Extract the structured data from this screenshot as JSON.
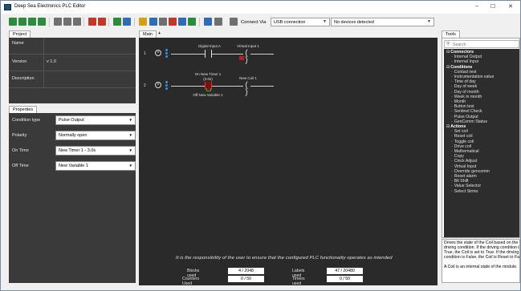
{
  "window": {
    "title": "Deep Sea Electronics PLC Editor",
    "controls": [
      "–",
      "☐",
      "✕"
    ]
  },
  "toolbar": {
    "connect_label": "Connect Via",
    "connection_type": "USB connection",
    "device": "No devices detected"
  },
  "project": {
    "tab_label": "Project",
    "rows": [
      {
        "label": "Name",
        "value": ""
      },
      {
        "label": "Version",
        "value": "v 1.0"
      },
      {
        "label": "Description",
        "value": ""
      }
    ]
  },
  "properties": {
    "tab_label": "Properties",
    "rows": [
      {
        "label": "Condition type",
        "value": "Pulse Output"
      },
      {
        "label": "Polarity",
        "value": "Normally open"
      },
      {
        "label": "On Time",
        "value": "New Timer 1 - 3.0s"
      },
      {
        "label": "Off Time",
        "value": "New Variable 1"
      }
    ]
  },
  "main": {
    "tab_label": "Main",
    "add_tab": "+",
    "rungs": [
      {
        "number": "1",
        "contact_label": "Digital Input A",
        "coil_label": "Virtual Input 1",
        "coil_symbol": "( )"
      },
      {
        "number": "2",
        "contact_label": "On New Timer 1",
        "contact_sublabel": "(3.0s)",
        "contact_bottom_label": "Off New Variable 1",
        "coil_label": "New Coil 1",
        "coil_symbol": "( )"
      }
    ],
    "notice": "It is the responsibility of the user to ensure that the configured PLC functionality operates as intended",
    "stats": [
      {
        "label": "Blocks used",
        "value": "4 / 2048"
      },
      {
        "label": "Labels used",
        "value": "47 / 20480"
      },
      {
        "label": "Counters Used",
        "value": "0 / 50"
      },
      {
        "label": "Timers used",
        "value": "0 / 50"
      }
    ]
  },
  "tools": {
    "tab_label": "Tools",
    "search_placeholder": "Search",
    "tree": [
      {
        "type": "cat",
        "label": "Connectors"
      },
      {
        "type": "item",
        "label": "Internal Output"
      },
      {
        "type": "item",
        "label": "Internal Input"
      },
      {
        "type": "cat",
        "label": "Conditions"
      },
      {
        "type": "item",
        "label": "Contact test"
      },
      {
        "type": "item",
        "label": "Instrumentation value"
      },
      {
        "type": "item",
        "label": "Time of day"
      },
      {
        "type": "item",
        "label": "Day of week"
      },
      {
        "type": "item",
        "label": "Day of month"
      },
      {
        "type": "item",
        "label": "Week in month"
      },
      {
        "type": "item",
        "label": "Month"
      },
      {
        "type": "item",
        "label": "Button test"
      },
      {
        "type": "item",
        "label": "Sentinel Check"
      },
      {
        "type": "item",
        "label": "Pulse Output"
      },
      {
        "type": "item",
        "label": "GenComm Status"
      },
      {
        "type": "cat",
        "label": "Actions"
      },
      {
        "type": "item",
        "label": "Set coil"
      },
      {
        "type": "item",
        "label": "Reset coil"
      },
      {
        "type": "item",
        "label": "Toggle coil"
      },
      {
        "type": "item",
        "label": "Drive coil"
      },
      {
        "type": "item",
        "label": "Mathematical"
      },
      {
        "type": "item",
        "label": "Copy"
      },
      {
        "type": "item",
        "label": "Clock Adjust"
      },
      {
        "type": "item",
        "label": "Virtual Input"
      },
      {
        "type": "item",
        "label": "Override gencomm"
      },
      {
        "type": "item",
        "label": "Reset alarm"
      },
      {
        "type": "item",
        "label": "Bit Shift"
      },
      {
        "type": "item",
        "label": "Value Selector"
      },
      {
        "type": "item",
        "label": "Select Strmo"
      }
    ],
    "description_lines": [
      "Drives the state of the Coil based on the",
      "driving condition. If the driving condition is",
      "True, the Coil is set to True. If the driving",
      "condition is False, the Coil is Reset to False.",
      "",
      "A Coil is an internal state of the module."
    ]
  }
}
